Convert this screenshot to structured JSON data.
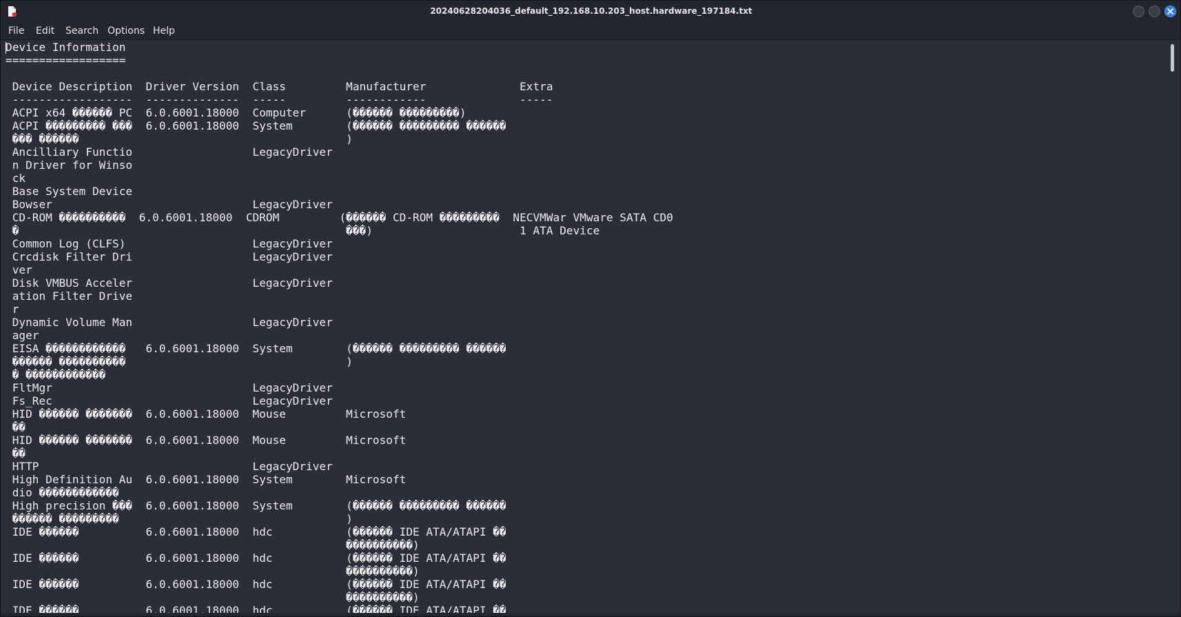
{
  "window": {
    "title": "20240628204036_default_192.168.10.203_host.hardware_197184.txt",
    "app_icon": "document-red-icon",
    "controls": [
      "minimize-icon",
      "maximize-icon",
      "close-icon"
    ],
    "accent_color": "#2f7fe0"
  },
  "menubar": {
    "items": [
      "File",
      "Edit",
      "Search",
      "Options",
      "Help"
    ]
  },
  "editor": {
    "lines": [
      "Device Information",
      "==================",
      "",
      " Device Description  Driver Version  Class         Manufacturer              Extra",
      " ------------------  --------------  -----         ------------              -----",
      " ACPI x64 ������ PC  6.0.6001.18000  Computer      (������ ���������)",
      " ACPI ��������� ���  6.0.6001.18000  System        (������ ��������� ������",
      " ��� ������                                        )",
      " Ancilliary Functio                  LegacyDriver",
      " n Driver for Winso",
      " ck",
      " Base System Device",
      " Bowser                              LegacyDriver",
      " CD-ROM ����������  6.0.6001.18000  CDROM         (������ CD-ROM ���������  NECVMWar VMware SATA CD0",
      " �                                                 ���)                      1 ATA Device",
      " Common Log (CLFS)                   LegacyDriver",
      " Crcdisk Filter Dri                  LegacyDriver",
      " ver",
      " Disk VMBUS Acceler                  LegacyDriver",
      " ation Filter Drive",
      " r",
      " Dynamic Volume Man                  LegacyDriver",
      " ager",
      " EISA ������������   6.0.6001.18000  System        (������ ��������� ������",
      " ������ ����������                                 )",
      " � ������������",
      " FltMgr                              LegacyDriver",
      " Fs_Rec                              LegacyDriver",
      " HID ������ �������  6.0.6001.18000  Mouse         Microsoft",
      " ��",
      " HID ������ �������  6.0.6001.18000  Mouse         Microsoft",
      " ��",
      " HTTP                                LegacyDriver",
      " High Definition Au  6.0.6001.18000  System        Microsoft",
      " dio ������������",
      " High precision ���  6.0.6001.18000  System        (������ ��������� ������",
      " ������ ���������                                  )",
      " IDE ������          6.0.6001.18000  hdc           (������ IDE ATA/ATAPI ��",
      "                                                   ����������)",
      " IDE ������          6.0.6001.18000  hdc           (������ IDE ATA/ATAPI ��",
      "                                                   ����������)",
      " IDE ������          6.0.6001.18000  hdc           (������ IDE ATA/ATAPI ��",
      "                                                   ����������)",
      " IDE ������          6.0.6001.18000  hdc           (������ IDE ATA/ATAPI ��"
    ]
  }
}
